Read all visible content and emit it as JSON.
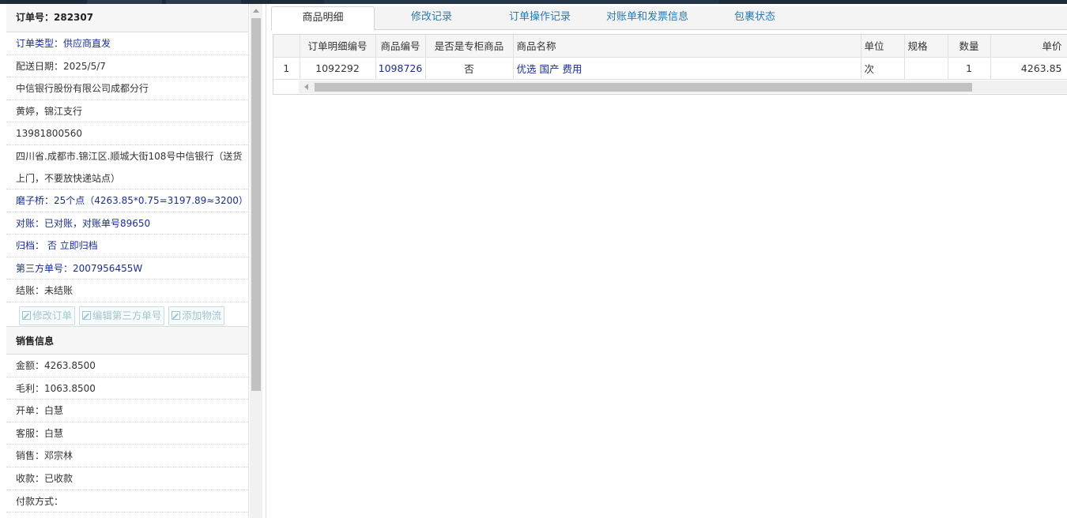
{
  "order": {
    "number_label": "订单号：282307",
    "type": "订单类型：供应商直发",
    "delivery_date": "配送日期：2025/5/7",
    "company": "中信银行股份有限公司成都分行",
    "contact": "黄婷，锦江支行",
    "phone": "13981800560",
    "address": "四川省.成都市.锦江区.顺城大街108号中信银行（送货上门，不要放快递站点）",
    "note": "磨子桥：25个点（4263.85*0.75=3197.89≈3200）",
    "reconcile": "对账：已对账，对账单号89650",
    "archive": "归档： 否 立即归档",
    "third_party": "第三方单号：2007956455W",
    "settle": "结账：未结账"
  },
  "actions": {
    "edit_order": "修改订单",
    "edit_third": "编辑第三方单号",
    "add_logistics": "添加物流"
  },
  "sales": {
    "title": "销售信息",
    "amount": "金额：4263.8500",
    "profit": "毛利：1063.8500",
    "issuer": "开单：白慧",
    "service": "客服：白慧",
    "seller": "销售：邓宗林",
    "payment": "收款：已收款",
    "method": "付款方式："
  },
  "tabs": [
    "商品明细",
    "修改记录",
    "订单操作记录",
    "对账单和发票信息",
    "包裹状态"
  ],
  "table": {
    "headers": [
      "",
      "订单明细编号",
      "商品编号",
      "是否是专柜商品",
      "商品名称",
      "单位",
      "规格",
      "数量",
      "单价"
    ],
    "rows": [
      [
        "1",
        "1092292",
        "1098726",
        "否",
        "优选 国产 费用",
        "次",
        "",
        "1",
        "4263.85"
      ]
    ]
  },
  "colors": {
    "link": "#1a2f8f",
    "tab_text": "#2a7ab0"
  }
}
